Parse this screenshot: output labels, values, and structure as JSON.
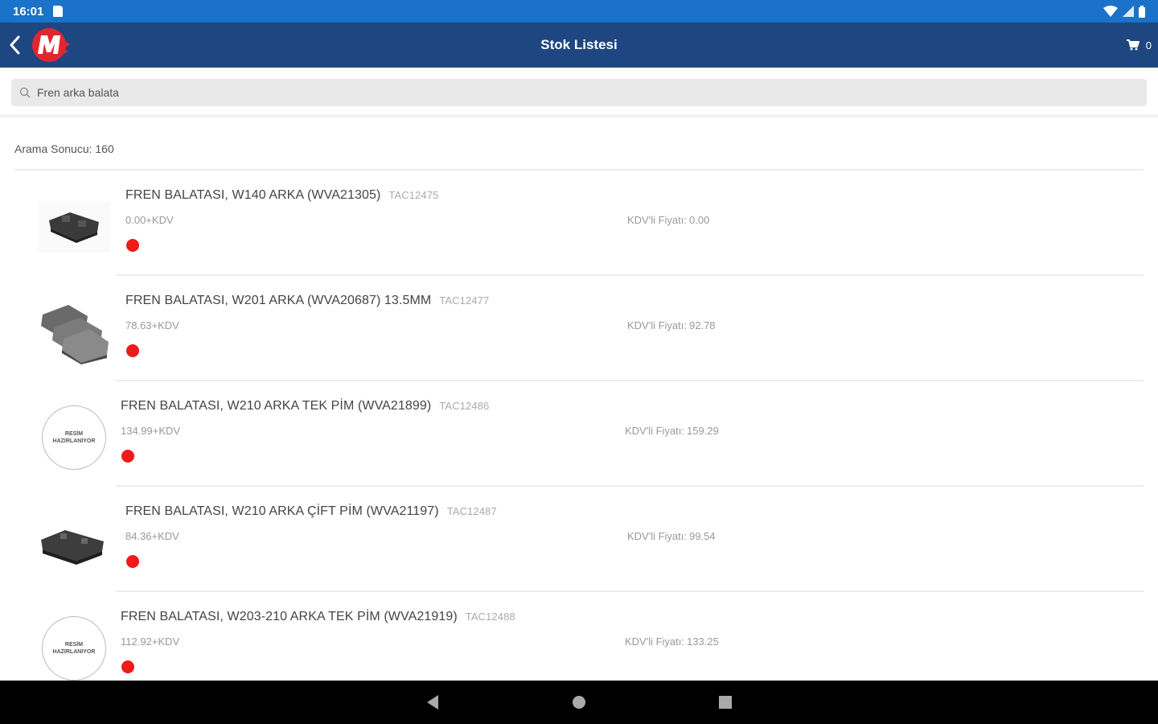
{
  "status_bar": {
    "time": "16:01"
  },
  "app_bar": {
    "title": "Stok Listesi",
    "cart_count": "0"
  },
  "search": {
    "value": "Fren arka balata",
    "placeholder": "Fren arka balata"
  },
  "results": {
    "count_label": "Arama Sonucu:",
    "count": "160"
  },
  "items": [
    {
      "name": "FREN BALATASI, W140 ARKA (WVA21305)",
      "code": "TAC12475",
      "price": "0.00+KDV",
      "kdv_label": "KDV'li Fiyatı:",
      "kdv_price": "0.00",
      "image": "brake-pad-photo"
    },
    {
      "name": "FREN BALATASI, W201 ARKA (WVA20687) 13.5MM",
      "code": "TAC12477",
      "price": "78.63+KDV",
      "kdv_label": "KDV'li Fiyatı:",
      "kdv_price": "92.78",
      "image": "brake-pad-photo"
    },
    {
      "name": "FREN BALATASI, W210 ARKA TEK PİM (WVA21899)",
      "code": "TAC12486",
      "price": "134.99+KDV",
      "kdv_label": "KDV'li Fiyatı:",
      "kdv_price": "159.29",
      "image": "placeholder",
      "placeholder_line1": "RESİM",
      "placeholder_line2": "HAZIRLANIYOR"
    },
    {
      "name": "FREN BALATASI, W210 ARKA ÇİFT PİM (WVA21197)",
      "code": "TAC12487",
      "price": "84.36+KDV",
      "kdv_label": "KDV'li Fiyatı:",
      "kdv_price": "99.54",
      "image": "brake-pad-photo"
    },
    {
      "name": "FREN BALATASI, W203-210 ARKA TEK PİM (WVA21919)",
      "code": "TAC12488",
      "price": "112.92+KDV",
      "kdv_label": "KDV'li Fiyatı:",
      "kdv_price": "133.25",
      "image": "placeholder",
      "placeholder_line1": "RESİM",
      "placeholder_line2": "HAZIRLANIYOR"
    }
  ],
  "colors": {
    "status_bar": "#1a73c8",
    "app_bar": "#1e4681",
    "stock_dot": "#ef1a1a",
    "logo_red": "#e3262e"
  }
}
